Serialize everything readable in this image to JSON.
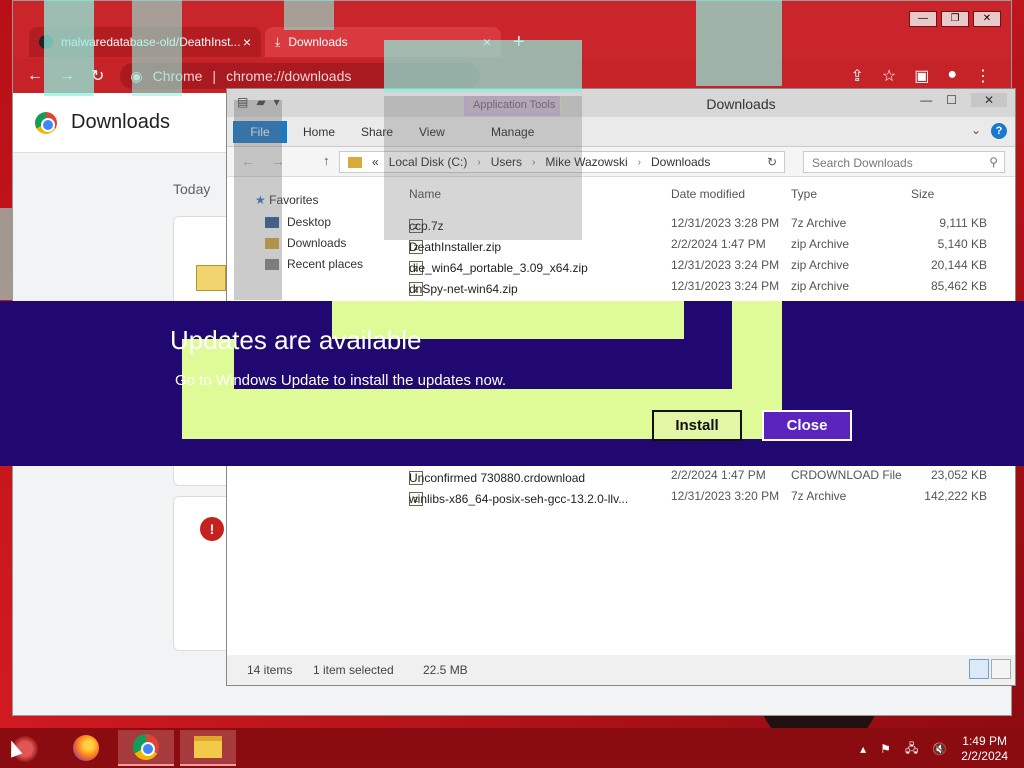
{
  "chrome": {
    "tabs": [
      {
        "label": "malwaredatabase-old/DeathInst...",
        "close": "×"
      },
      {
        "label": "Downloads",
        "close": "×"
      }
    ],
    "new_tab": "+",
    "omnibox_label": "Chrome",
    "url": "chrome://downloads",
    "page_title": "Downloads",
    "section_today": "Today"
  },
  "explorer": {
    "title": "Downloads",
    "app_tools": "Application Tools",
    "ribbon": {
      "file": "File",
      "home": "Home",
      "share": "Share",
      "view": "View",
      "manage": "Manage"
    },
    "breadcrumb": [
      "«",
      "Local Disk (C:)",
      "Users",
      "Mike Wazowski",
      "Downloads"
    ],
    "search_placeholder": "Search Downloads",
    "favorites_label": "Favorites",
    "favorites": [
      "Desktop",
      "Downloads",
      "Recent places"
    ],
    "columns": {
      "name": "Name",
      "date": "Date modified",
      "type": "Type",
      "size": "Size"
    },
    "files": [
      {
        "name": "ccp.7z",
        "date": "12/31/2023 3:28 PM",
        "type": "7z Archive",
        "size": "9,111 KB"
      },
      {
        "name": "DeathInstaller.zip",
        "date": "2/2/2024 1:47 PM",
        "type": "zip Archive",
        "size": "5,140 KB"
      },
      {
        "name": "die_win64_portable_3.09_x64.zip",
        "date": "12/31/2023 3:24 PM",
        "type": "zip Archive",
        "size": "20,144 KB"
      },
      {
        "name": "dnSpy-net-win64.zip",
        "date": "12/31/2023 3:24 PM",
        "type": "zip Archive",
        "size": "85,462 KB"
      }
    ],
    "files_lower": [
      {
        "name": "Unconfirmed 730880.crdownload",
        "date": "2/2/2024 1:47 PM",
        "type": "CRDOWNLOAD File",
        "size": "23,052 KB"
      },
      {
        "name": "winlibs-x86_64-posix-seh-gcc-13.2.0-llv...",
        "date": "12/31/2023 3:20 PM",
        "type": "7z Archive",
        "size": "142,222 KB"
      }
    ],
    "status": {
      "items": "14 items",
      "selected": "1 item selected",
      "size": "22.5 MB"
    }
  },
  "banner": {
    "title": "Updates are available",
    "message": "Go to Windows Update to install the updates now.",
    "install_label": "Install",
    "close_label": "Close"
  },
  "taskbar": {
    "time": "1:49 PM",
    "date": "2/2/2024",
    "apps": [
      "firefox-icon",
      "chrome-icon",
      "file-explorer-icon"
    ]
  },
  "colors": {
    "banner_bg": "#200870",
    "banner_lime": "#dffb97",
    "close_btn": "#5b25bd",
    "taskbar": "#8a0c10"
  }
}
